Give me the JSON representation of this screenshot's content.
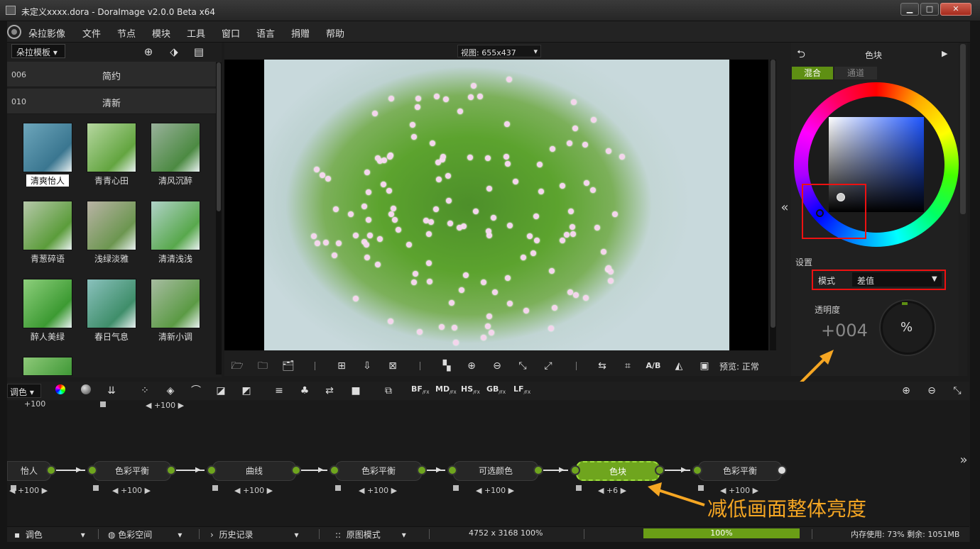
{
  "window": {
    "title": "未定义xxxx.dora - DoraImage v2.0.0 Beta x64",
    "min": "▁",
    "max": "□",
    "close": "✕"
  },
  "menu": [
    "朵拉影像",
    "文件",
    "节点",
    "模块",
    "工具",
    "窗口",
    "语言",
    "捐赠",
    "帮助"
  ],
  "left": {
    "template_select": "朵拉模板",
    "categories": [
      {
        "code": "006",
        "name": "简约"
      },
      {
        "code": "010",
        "name": "清新"
      }
    ],
    "thumbs": [
      {
        "label": "清爽怡人",
        "selected": true,
        "colors": [
          "#6da6bb",
          "#3a7690"
        ]
      },
      {
        "label": "青青心田",
        "colors": [
          "#b6d7a0",
          "#63a540"
        ]
      },
      {
        "label": "清风沉醉",
        "colors": [
          "#99b19b",
          "#4c8a42"
        ]
      },
      {
        "label": "青葱碎语",
        "colors": [
          "#b6c8aa",
          "#5b9c3a"
        ]
      },
      {
        "label": "浅绿淡雅",
        "colors": [
          "#b9b3a5",
          "#6c9650"
        ]
      },
      {
        "label": "清清浅浅",
        "colors": [
          "#b0d2c8",
          "#58a84c"
        ]
      },
      {
        "label": "醉人美绿",
        "colors": [
          "#8dcf7c",
          "#3c9a32"
        ]
      },
      {
        "label": "春日气息",
        "colors": [
          "#8ac1bd",
          "#3f8e6a"
        ]
      },
      {
        "label": "清新小调",
        "colors": [
          "#a7bca1",
          "#5b9a44"
        ]
      },
      {
        "label": "",
        "colors": [
          "#8ec979",
          "#3f9836"
        ]
      }
    ]
  },
  "view": {
    "zoom_select": "视图: 655x437",
    "preview_label": "预览: 正常"
  },
  "right": {
    "title": "色块",
    "tabs": [
      "混合",
      "通道"
    ],
    "settings_label": "设置",
    "mode_label": "模式",
    "mode_value": "差值",
    "opacity_label": "透明度",
    "opacity_value": "+004",
    "knob_label": "%",
    "collapse": "«",
    "expand": "»"
  },
  "toolrow": {
    "adjust_select": "调色",
    "fx": [
      {
        "main": "BF",
        "sub": "/FX"
      },
      {
        "main": "MD",
        "sub": "/FX"
      },
      {
        "main": "HS",
        "sub": "/FX"
      },
      {
        "main": "GB",
        "sub": "/FX"
      },
      {
        "main": "LF",
        "sub": "/FX"
      }
    ]
  },
  "nodes": [
    {
      "label": "怡人",
      "value": "+100"
    },
    {
      "label": "色彩平衡",
      "value": "+100"
    },
    {
      "label": "曲线",
      "value": "+100"
    },
    {
      "label": "色彩平衡",
      "value": "+100"
    },
    {
      "label": "可选颜色",
      "value": "+100"
    },
    {
      "label": "色块",
      "value": "+6",
      "active": true
    },
    {
      "label": "色彩平衡",
      "value": "+100"
    }
  ],
  "top_values": [
    "+100",
    "+100"
  ],
  "annotation": "减低画面整体亮度",
  "status": {
    "adjust": "调色",
    "colorspace": "色彩空间",
    "history": "历史记录",
    "origmode": "原图模式",
    "size": "4752 x 3168  100%",
    "progress_value": 1.0,
    "progress_text": "100%",
    "memory": "内存使用: 73%  剩余: 1051MB"
  }
}
